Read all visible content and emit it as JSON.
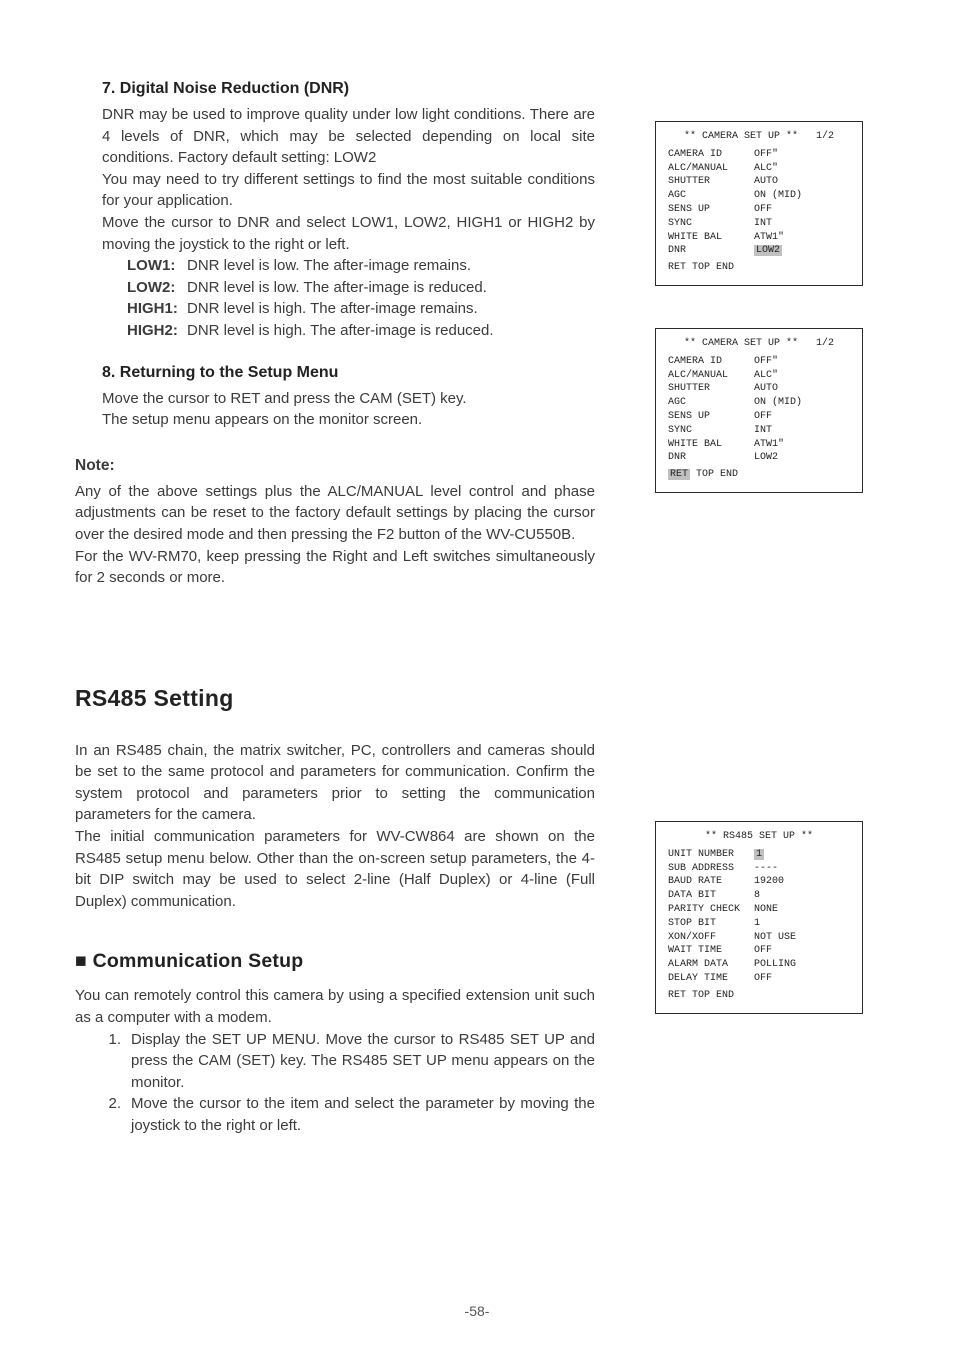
{
  "section7": {
    "num": "7.",
    "title": "Digital Noise Reduction (DNR)",
    "p1": "DNR may be used to improve quality under low light conditions. There are 4 levels of DNR, which may be selected depending on local site conditions. Factory default setting: LOW2",
    "p2": "You may need to try different settings to find the most suitable conditions for your application.",
    "p3": "Move the cursor to DNR and select LOW1, LOW2, HIGH1 or HIGH2 by moving the joystick to the right or left.",
    "items": [
      {
        "label": "LOW1:",
        "desc": "DNR level is low. The after-image remains."
      },
      {
        "label": "LOW2:",
        "desc": "DNR level is low. The after-image is reduced."
      },
      {
        "label": "HIGH1:",
        "desc": "DNR level is high. The after-image remains."
      },
      {
        "label": "HIGH2:",
        "desc": "DNR level is high. The after-image is reduced."
      }
    ]
  },
  "section8": {
    "num": "8.",
    "title": "Returning to the Setup Menu",
    "p1": "Move the cursor to RET and press the CAM (SET) key.",
    "p2": "The setup menu appears on the monitor screen."
  },
  "note": {
    "label": "Note:",
    "p1": "Any of the above settings plus the ALC/MANUAL level control and phase adjustments can be reset to the factory default settings by placing the cursor over the desired mode and then pressing the F2 button of the WV-CU550B.",
    "p2": "For the WV-RM70, keep pressing the Right and Left switches simultaneously for 2 seconds or more."
  },
  "rs485_intro": {
    "big_title": "RS485 Setting",
    "p1": "In an RS485 chain, the matrix switcher, PC, controllers and cameras should be set to the same protocol and parameters for communication. Confirm the system protocol and parameters prior to setting the communication parameters for the camera.",
    "p2": "The initial communication parameters for WV-CW864 are shown on the RS485 setup menu below. Other than the on-screen setup parameters, the 4-bit DIP switch may be used to select 2-line (Half Duplex) or 4-line (Full Duplex) communication."
  },
  "comm": {
    "title": "■ Communication Setup",
    "p1": "You can remotely control this camera by using a specified extension unit such as a computer with a modem.",
    "steps": [
      "Display the SET UP MENU. Move the cursor to RS485 SET UP and press the CAM (SET) key. The RS485 SET UP menu appears on the monitor.",
      "Move the cursor to the item and select the parameter by moving the joystick to the right or left."
    ]
  },
  "screen1": {
    "title": "** CAMERA SET UP **   1/2",
    "rows": [
      [
        "CAMERA ID",
        "OFF\""
      ],
      [
        "ALC/MANUAL",
        "ALC\""
      ],
      [
        "SHUTTER",
        "AUTO"
      ],
      [
        "AGC",
        "ON (MID)"
      ],
      [
        "SENS UP",
        "OFF"
      ],
      [
        "SYNC",
        "INT"
      ],
      [
        "WHITE BAL",
        "ATW1\""
      ],
      [
        "DNR",
        "LOW2"
      ]
    ],
    "hl_row": 7,
    "foot_left": "RET  TOP  END",
    "foot_right": ""
  },
  "screen2": {
    "title": "** CAMERA SET UP **   1/2",
    "rows": [
      [
        "CAMERA ID",
        "OFF\""
      ],
      [
        "ALC/MANUAL",
        "ALC\""
      ],
      [
        "SHUTTER",
        "AUTO"
      ],
      [
        "AGC",
        "ON (MID)"
      ],
      [
        "SENS UP",
        "OFF"
      ],
      [
        "SYNC",
        "INT"
      ],
      [
        "WHITE BAL",
        "ATW1\""
      ],
      [
        "DNR",
        "LOW2"
      ]
    ],
    "hl_row": -1,
    "foot_hl": "RET",
    "foot_rest": "  TOP  END"
  },
  "screen3": {
    "title": "** RS485 SET UP **",
    "rows": [
      [
        "UNIT NUMBER",
        "1"
      ],
      [
        "SUB ADDRESS",
        "----"
      ],
      [
        "BAUD RATE",
        "19200"
      ],
      [
        "DATA BIT",
        "8"
      ],
      [
        "PARITY CHECK",
        "NONE"
      ],
      [
        "STOP BIT",
        "1"
      ],
      [
        "XON/XOFF",
        "NOT USE"
      ],
      [
        "WAIT TIME",
        "OFF"
      ],
      [
        "ALARM DATA",
        "POLLING"
      ],
      [
        "DELAY TIME",
        "OFF"
      ]
    ],
    "hl_row": 0,
    "foot_left": "RET  TOP  END"
  },
  "page_number": "-58-"
}
